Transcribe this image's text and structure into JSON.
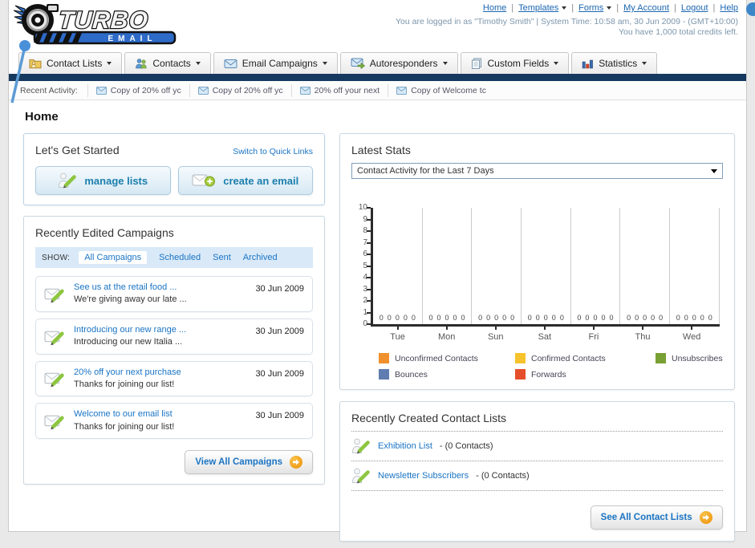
{
  "logo": {
    "title": "TURBO",
    "subtitle": "EMAIL"
  },
  "header": {
    "separator": "|",
    "links": [
      {
        "label": "Home",
        "dropdown": false
      },
      {
        "label": "Templates",
        "dropdown": true
      },
      {
        "label": "Forms",
        "dropdown": true
      },
      {
        "label": "My Account",
        "dropdown": false
      },
      {
        "label": "Logout",
        "dropdown": false
      },
      {
        "label": "Help",
        "dropdown": false
      }
    ],
    "login_info": "You are logged in as \"Timothy Smith\" | System Time: 10:58 am, 30 Jun 2009 - (GMT+10:00)",
    "credits_info": "You have 1,000 total credits left."
  },
  "nav": {
    "tabs": [
      {
        "label": "Contact Lists",
        "icon": "folder-icon"
      },
      {
        "label": "Contacts",
        "icon": "people-icon"
      },
      {
        "label": "Email Campaigns",
        "icon": "envelope-icon"
      },
      {
        "label": "Autoresponders",
        "icon": "envelope-arrow-icon"
      },
      {
        "label": "Custom Fields",
        "icon": "pages-icon"
      },
      {
        "label": "Statistics",
        "icon": "bar-chart-icon"
      }
    ]
  },
  "recent_activity": {
    "label": "Recent Activity:",
    "items": [
      "Copy of 20% off yc",
      "Copy of 20% off yc",
      "20% off your next",
      "Copy of Welcome tc"
    ]
  },
  "page_title": "Home",
  "get_started": {
    "title": "Let's Get Started",
    "switch_link": "Switch to Quick Links",
    "manage_lists_label": "manage lists",
    "create_email_label": "create an email"
  },
  "campaigns": {
    "title": "Recently Edited Campaigns",
    "show_label": "SHOW:",
    "filters": [
      "All Campaigns",
      "Scheduled",
      "Sent",
      "Archived"
    ],
    "active_filter": "All Campaigns",
    "items": [
      {
        "title": "See us at the retail food ...",
        "subtitle": "We're giving away our late ...",
        "date": "30 Jun 2009"
      },
      {
        "title": "Introducing our new range ...",
        "subtitle": "Introducing our new Italia ...",
        "date": "30 Jun 2009"
      },
      {
        "title": "20% off your next purchase",
        "subtitle": "Thanks for joining our list!",
        "date": "30 Jun 2009"
      },
      {
        "title": "Welcome to our email list",
        "subtitle": "Thanks for joining our list!",
        "date": "30 Jun 2009"
      }
    ],
    "view_all_label": "View All Campaigns"
  },
  "latest_stats": {
    "title": "Latest Stats",
    "selected_option": "Contact Activity for the Last 7 Days"
  },
  "chart_data": {
    "type": "bar",
    "title": "Contact Activity for the Last 7 Days",
    "categories": [
      "Tue",
      "Mon",
      "Sun",
      "Sat",
      "Fri",
      "Thu",
      "Wed"
    ],
    "series": [
      {
        "name": "Unconfirmed Contacts",
        "color": "#f0912d",
        "values": [
          0,
          0,
          0,
          0,
          0,
          0,
          0
        ]
      },
      {
        "name": "Confirmed Contacts",
        "color": "#f6c32c",
        "values": [
          0,
          0,
          0,
          0,
          0,
          0,
          0
        ]
      },
      {
        "name": "Unsubscribes",
        "color": "#79a033",
        "values": [
          0,
          0,
          0,
          0,
          0,
          0,
          0
        ]
      },
      {
        "name": "Bounces",
        "color": "#5f7db0",
        "values": [
          0,
          0,
          0,
          0,
          0,
          0,
          0
        ]
      },
      {
        "name": "Forwards",
        "color": "#e54e2b",
        "values": [
          0,
          0,
          0,
          0,
          0,
          0,
          0
        ]
      }
    ],
    "ylim": [
      0,
      10
    ],
    "y_ticks": [
      0,
      1,
      2,
      3,
      4,
      5,
      6,
      7,
      8,
      9,
      10
    ],
    "grid": true,
    "legend_position": "bottom"
  },
  "contact_lists": {
    "title": "Recently Created Contact Lists",
    "items": [
      {
        "name": "Exhibition List",
        "detail": "- (0 Contacts)"
      },
      {
        "name": "Newsletter Subscribers",
        "detail": "- (0 Contacts)"
      }
    ],
    "see_all_label": "See All Contact Lists"
  },
  "colors": {
    "navy_bar": "#16395f",
    "link_blue": "#1a74c4",
    "accent_orange": "#ee8f06",
    "pin_blue": "#5b9bd5"
  }
}
